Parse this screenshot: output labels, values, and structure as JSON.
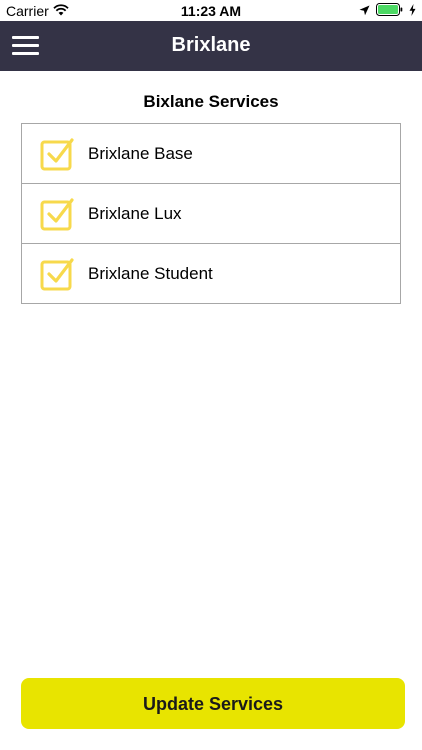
{
  "status_bar": {
    "carrier": "Carrier",
    "time": "11:23 AM",
    "icons": [
      "wifi-icon",
      "location-arrow-icon",
      "battery-icon",
      "charging-bolt-icon"
    ],
    "battery_color": "#4cd964"
  },
  "nav": {
    "title": "Brixlane",
    "menu_icon": "hamburger-menu-icon",
    "background": "#343346"
  },
  "services": {
    "title": "Bixlane Services",
    "items": [
      {
        "label": "Brixlane Base",
        "checked": true
      },
      {
        "label": "Brixlane Lux",
        "checked": true
      },
      {
        "label": "Brixlane Student",
        "checked": true
      }
    ],
    "check_color": "#f7d94c"
  },
  "footer": {
    "button_label": "Update Services",
    "button_color": "#e8e400"
  }
}
